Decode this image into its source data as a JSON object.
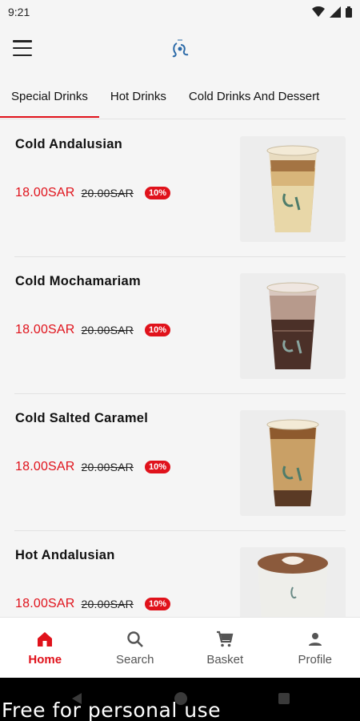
{
  "status": {
    "time": "9:21"
  },
  "app": {
    "brand_text": "Marayam"
  },
  "tabs": [
    {
      "label": "Special Drinks"
    },
    {
      "label": "Hot Drinks"
    },
    {
      "label": "Cold Drinks And Dessert"
    }
  ],
  "products": [
    {
      "name": "Cold Andalusian",
      "price": "18.00SAR",
      "old_price": "20.00SAR",
      "discount": "10%",
      "image": "iced-latte-cup"
    },
    {
      "name": "Cold Mochamariam",
      "price": "18.00SAR",
      "old_price": "20.00SAR",
      "discount": "10%",
      "image": "iced-mocha-cup"
    },
    {
      "name": "Cold Salted Caramel",
      "price": "18.00SAR",
      "old_price": "20.00SAR",
      "discount": "10%",
      "image": "iced-caramel-cup"
    },
    {
      "name": "Hot Andalusian",
      "price": "18.00SAR",
      "old_price": "20.00SAR",
      "discount": "10%",
      "image": "hot-latte-cup"
    }
  ],
  "nav": [
    {
      "label": "Home",
      "icon": "home-icon"
    },
    {
      "label": "Search",
      "icon": "search-icon"
    },
    {
      "label": "Basket",
      "icon": "cart-icon"
    },
    {
      "label": "Profile",
      "icon": "person-icon"
    }
  ],
  "watermark": "Free for personal use",
  "colors": {
    "accent": "#e0121b",
    "background": "#f5f5f5"
  }
}
